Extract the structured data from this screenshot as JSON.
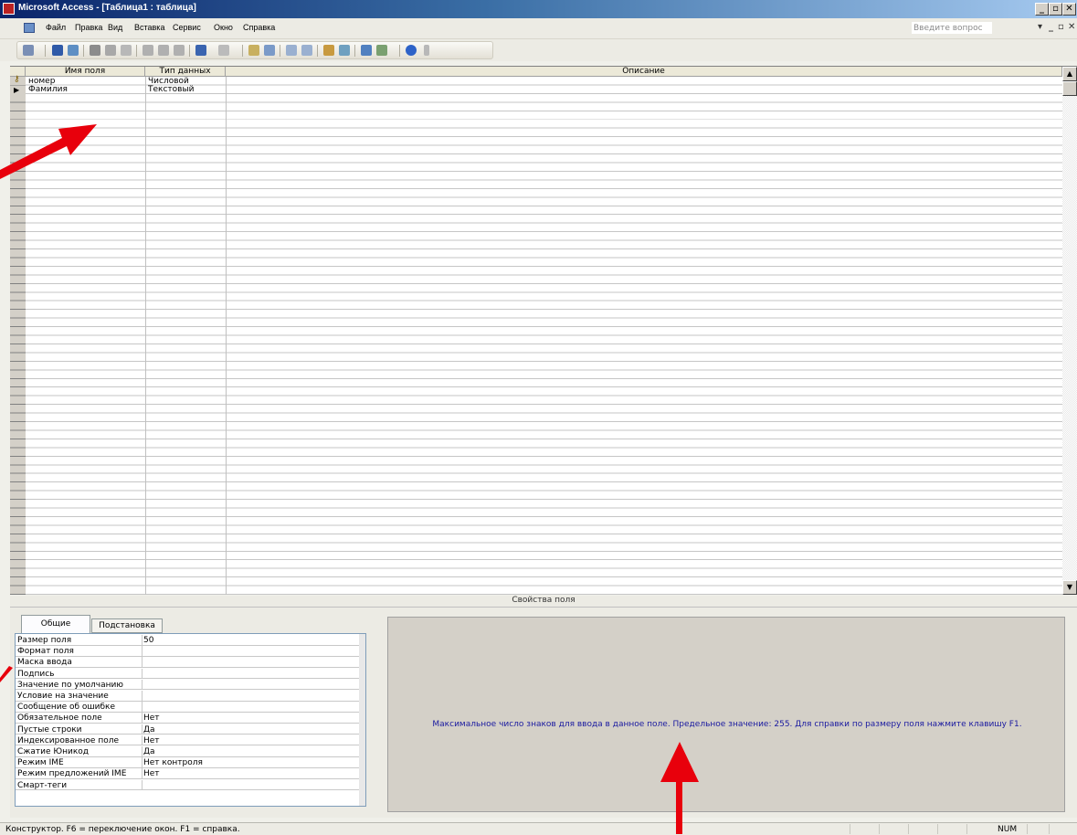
{
  "window": {
    "title": "Microsoft Access - [Таблица1 : таблица]"
  },
  "menubar": {
    "items": [
      "Файл",
      "Правка",
      "Вид",
      "Вставка",
      "Сервис",
      "Окно",
      "Справка"
    ],
    "ask_placeholder": "Введите вопрос"
  },
  "design_grid": {
    "columns": [
      "Имя поля",
      "Тип данных",
      "Описание"
    ],
    "rows": [
      {
        "name": "номер",
        "type": "Числовой",
        "description": "",
        "primary_key": true
      },
      {
        "name": "Фамилия",
        "type": "Текстовый",
        "description": "",
        "current": true
      }
    ]
  },
  "field_properties": {
    "section_title": "Свойства поля",
    "tabs": [
      "Общие",
      "Подстановка"
    ],
    "active_tab": "Общие",
    "rows": [
      {
        "label": "Размер поля",
        "value": "50"
      },
      {
        "label": "Формат поля",
        "value": ""
      },
      {
        "label": "Маска ввода",
        "value": ""
      },
      {
        "label": "Подпись",
        "value": ""
      },
      {
        "label": "Значение по умолчанию",
        "value": ""
      },
      {
        "label": "Условие на значение",
        "value": ""
      },
      {
        "label": "Сообщение об ошибке",
        "value": ""
      },
      {
        "label": "Обязательное поле",
        "value": "Нет"
      },
      {
        "label": "Пустые строки",
        "value": "Да"
      },
      {
        "label": "Индексированное поле",
        "value": "Нет"
      },
      {
        "label": "Сжатие Юникод",
        "value": "Да"
      },
      {
        "label": "Режим IME",
        "value": "Нет контроля"
      },
      {
        "label": "Режим предложений IME",
        "value": "Нет"
      },
      {
        "label": "Смарт-теги",
        "value": ""
      }
    ],
    "help_text": "Максимальное число знаков для ввода в данное поле.  Предельное значение: 255.  Для справки по размеру поля нажмите клавишу F1."
  },
  "statusbar": {
    "text": "Конструктор.  F6 = переключение окон.  F1 = справка.",
    "num": "NUM"
  },
  "colors": {
    "annotation_arrow": "#e8000c",
    "help_text": "#1a1aa0",
    "title_bar": "#0a246a"
  }
}
